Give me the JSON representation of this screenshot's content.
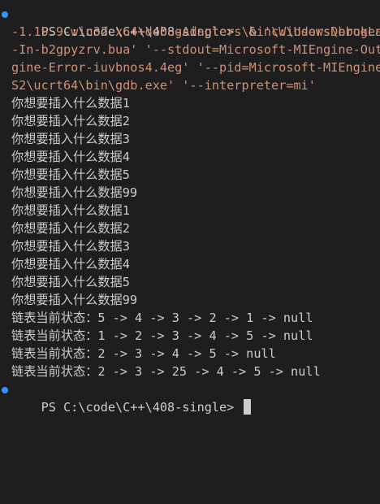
{
  "terminal": {
    "command": {
      "prompt": "PS C:\\code\\C++\\408-single> ",
      "op": " & ",
      "lines": [
        "'c:\\Users\\brokenarr0w",
        "-1.19.9-win32-x64\\debugAdapters\\bin\\WindowsDebugLau",
        "-In-b2gpyzrv.bua' '--stdout=Microsoft-MIEngine-Out-",
        "gine-Error-iuvbnos4.4eg' '--pid=Microsoft-MIEngine-",
        "S2\\ucrt64\\bin\\gdb.exe' '--interpreter=mi'"
      ]
    },
    "output": [
      "你想要插入什么数据1",
      "你想要插入什么数据2",
      "你想要插入什么数据3",
      "你想要插入什么数据4",
      "你想要插入什么数据5",
      "你想要插入什么数据99",
      "你想要插入什么数据1",
      "你想要插入什么数据2",
      "你想要插入什么数据3",
      "你想要插入什么数据4",
      "你想要插入什么数据5",
      "你想要插入什么数据99",
      "链表当前状态：5 -> 4 -> 3 -> 2 -> 1 -> null",
      "链表当前状态：1 -> 2 -> 3 -> 4 -> 5 -> null",
      "链表当前状态：2 -> 3 -> 4 -> 5 -> null",
      "链表当前状态：2 -> 3 -> 25 -> 4 -> 5 -> null"
    ],
    "final_prompt": "PS C:\\code\\C++\\408-single> ",
    "colors": {
      "background": "#1e1e1e",
      "text": "#cccccc",
      "string": "#ce9178",
      "prompt_dot": "#3794ff"
    }
  }
}
